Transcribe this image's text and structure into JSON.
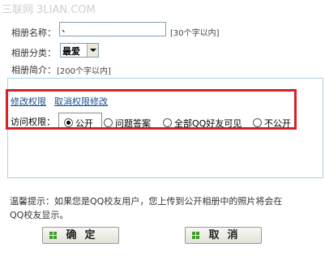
{
  "watermark": "三联网 3LIAN.COM",
  "form": {
    "name_label": "相册名称：",
    "name_value": "、",
    "name_hint": "[30个字以内]",
    "category_label": "相册分类：",
    "category_value": "最爱",
    "desc_label": "相册简介：",
    "desc_hint": "[200个字以内]"
  },
  "permission": {
    "modify_link": "修改权限",
    "cancel_link": "取消权限修改",
    "access_label": "访问权限：",
    "options": [
      {
        "label": "公开",
        "selected": true
      },
      {
        "label": "问题答案",
        "selected": false
      },
      {
        "label": "全部QQ好友可见",
        "selected": false
      },
      {
        "label": "不公开",
        "selected": false
      }
    ]
  },
  "notice": {
    "line1": "温馨提示：如果您是QQ校友用户，您上传到公开相册中的照片将会在",
    "line2": "QQ校友显示。"
  },
  "buttons": {
    "confirm": "确定",
    "cancel": "取消"
  },
  "colors": {
    "highlight_border": "#d62126",
    "link": "#1a4f8f",
    "textarea_border": "#a7d2e8",
    "button_icon": "#3a9a2a"
  }
}
